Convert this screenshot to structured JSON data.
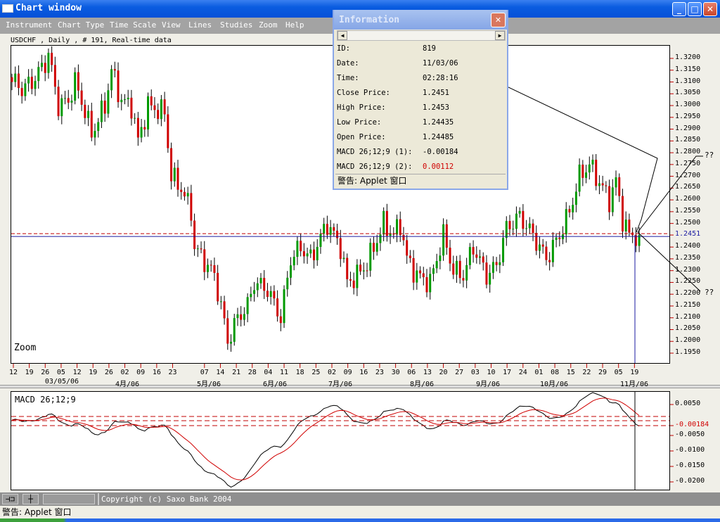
{
  "window": {
    "title": "Chart window",
    "minimize": "_",
    "maximize": "□",
    "close": "✕"
  },
  "menu": [
    "Instrument",
    "Chart Type",
    "Time Scale",
    "View",
    "Lines",
    "Studies",
    "Zoom",
    "Help"
  ],
  "chart_header": "USDCHF , Daily , # 191, Real-time data",
  "zoom_label": "Zoom",
  "macd_label": "MACD 26;12;9",
  "annotations": [
    "??",
    "??"
  ],
  "colors": {
    "up": "#009a00",
    "down": "#d00000",
    "current_price_line": "#1a1aa0",
    "dashed": "#c00000",
    "macd": "#000000",
    "signal": "#d00000"
  },
  "chart_data": [
    {
      "type": "candlestick",
      "instrument": "USDCHF",
      "y_ticks": [
        "1.3200",
        "1.3150",
        "1.3100",
        "1.3050",
        "1.3000",
        "1.2950",
        "1.2900",
        "1.2850",
        "1.2800",
        "1.2750",
        "1.2700",
        "1.2650",
        "1.2600",
        "1.2550",
        "1.2500",
        "1.2451",
        "1.2400",
        "1.2350",
        "1.2300",
        "1.2250",
        "1.2200",
        "1.2150",
        "1.2100",
        "1.2050",
        "1.2000",
        "1.1950"
      ],
      "ylim": [
        1.1925,
        1.326
      ],
      "current_price": 1.2451,
      "current_price_label": "1.2451",
      "x_ticks": [
        "12",
        "19",
        "26",
        "05",
        "12",
        "19",
        "26",
        "02",
        "09",
        "16",
        "23",
        "",
        "07",
        "14",
        "21",
        "28",
        "04",
        "11",
        "18",
        "25",
        "02",
        "09",
        "16",
        "23",
        "30",
        "06",
        "13",
        "20",
        "27",
        "03",
        "10",
        "17",
        "24",
        "01",
        "08",
        "15",
        "22",
        "29",
        "05",
        "19"
      ],
      "month_labels": [
        "03/05/06",
        "4月/06",
        "5月/06",
        "6月/06",
        "7月/06",
        "8月/06",
        "9月/06",
        "10月/06",
        "11月/06"
      ],
      "bars": 191,
      "close_keypoints": [
        [
          1,
          1.31
        ],
        [
          3,
          1.307
        ],
        [
          6,
          1.31
        ],
        [
          10,
          1.318
        ],
        [
          11,
          1.322
        ],
        [
          14,
          1.3
        ],
        [
          17,
          1.302
        ],
        [
          19,
          1.31
        ],
        [
          21,
          1.302
        ],
        [
          24,
          1.288
        ],
        [
          28,
          1.3
        ],
        [
          30,
          1.315
        ],
        [
          33,
          1.302
        ],
        [
          36,
          1.3
        ],
        [
          38,
          1.285
        ],
        [
          41,
          1.3
        ],
        [
          46,
          1.297
        ],
        [
          48,
          1.27
        ],
        [
          51,
          1.265
        ],
        [
          54,
          1.255
        ],
        [
          55,
          1.24
        ],
        [
          59,
          1.232
        ],
        [
          61,
          1.228
        ],
        [
          63,
          1.215
        ],
        [
          65,
          1.2
        ],
        [
          68,
          1.21
        ],
        [
          71,
          1.215
        ],
        [
          73,
          1.225
        ],
        [
          77,
          1.222
        ],
        [
          81,
          1.21
        ],
        [
          84,
          1.235
        ],
        [
          87,
          1.24
        ],
        [
          90,
          1.235
        ],
        [
          95,
          1.25
        ],
        [
          99,
          1.24
        ],
        [
          101,
          1.225
        ],
        [
          104,
          1.228
        ],
        [
          107,
          1.233
        ],
        [
          112,
          1.25
        ],
        [
          115,
          1.245
        ],
        [
          117,
          1.25
        ],
        [
          119,
          1.235
        ],
        [
          122,
          1.228
        ],
        [
          126,
          1.225
        ],
        [
          130,
          1.245
        ],
        [
          133,
          1.23
        ],
        [
          136,
          1.228
        ],
        [
          139,
          1.24
        ],
        [
          143,
          1.228
        ],
        [
          146,
          1.232
        ],
        [
          149,
          1.248
        ],
        [
          153,
          1.253
        ],
        [
          157,
          1.245
        ],
        [
          161,
          1.235
        ],
        [
          165,
          1.245
        ],
        [
          168,
          1.255
        ],
        [
          171,
          1.27
        ],
        [
          174,
          1.275
        ],
        [
          178,
          1.265
        ],
        [
          180,
          1.26
        ],
        [
          182,
          1.268
        ],
        [
          184,
          1.252
        ],
        [
          186,
          1.245
        ],
        [
          188,
          1.2451
        ]
      ]
    },
    {
      "type": "line",
      "title": "MACD 26;12;9",
      "y_ticks": [
        "0.0050",
        "-0.0050",
        "-0.0100",
        "-0.0150",
        "-0.0200"
      ],
      "ylim": [
        -0.0225,
        0.008
      ],
      "current_value_label": "-0.00184",
      "current_value": -0.00184,
      "signal_value": 0.00112
    }
  ],
  "info": {
    "title": "Information",
    "close": "✕",
    "rows": [
      {
        "label": "ID:",
        "value": "819"
      },
      {
        "label": "Date:",
        "value": "11/03/06"
      },
      {
        "label": "Time:",
        "value": "02:28:16"
      },
      {
        "label": "Close Price:",
        "value": "1.2451"
      },
      {
        "label": "High Price:",
        "value": "1.2453"
      },
      {
        "label": "Low Price:",
        "value": "1.24435"
      },
      {
        "label": "Open Price:",
        "value": "1.24485"
      },
      {
        "label": "MACD 26;12;9 (1):",
        "value": "-0.00184"
      },
      {
        "label": "MACD 26;12;9 (2):",
        "value": "0.00112"
      }
    ],
    "status": "警告: Applet 窗口"
  },
  "toolbar": {
    "pin_button": "⊣⊐",
    "crosshair_button": "┼",
    "copyright": "Copyright (c) Saxo Bank 2004"
  },
  "status": "警告: Applet 窗口"
}
